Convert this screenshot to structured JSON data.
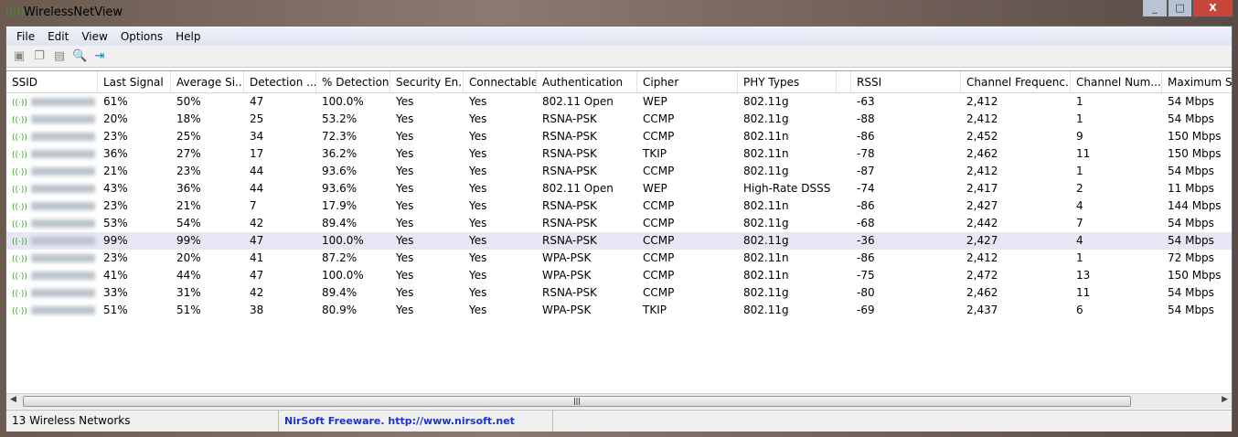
{
  "window": {
    "title": "WirelessNetView",
    "minimize": "_",
    "maximize": "□",
    "close": "X"
  },
  "menu": [
    "File",
    "Edit",
    "View",
    "Options",
    "Help"
  ],
  "toolbar": [
    {
      "icon": "save-icon",
      "glyph": "▣"
    },
    {
      "icon": "copy-icon",
      "glyph": "❐"
    },
    {
      "icon": "properties-icon",
      "glyph": "▤"
    },
    {
      "icon": "html-report-icon",
      "glyph": "🔍"
    },
    {
      "icon": "exit-icon",
      "glyph": "⇥"
    }
  ],
  "columns": [
    "SSID",
    "Last Signal",
    "Average Si...",
    "Detection ...",
    "% Detection",
    "Security En...",
    "Connectable",
    "Authentication",
    "Cipher",
    "PHY Types",
    "",
    "RSSI",
    "Channel Frequenc...",
    "Channel Num...",
    "Maximum Spe"
  ],
  "rows": [
    [
      "",
      "61%",
      "50%",
      "47",
      "100.0%",
      "Yes",
      "Yes",
      "802.11 Open",
      "WEP",
      "802.11g",
      "",
      "-63",
      "2,412",
      "1",
      "54 Mbps"
    ],
    [
      "",
      "20%",
      "18%",
      "25",
      "53.2%",
      "Yes",
      "Yes",
      "RSNA-PSK",
      "CCMP",
      "802.11g",
      "",
      "-88",
      "2,412",
      "1",
      "54 Mbps"
    ],
    [
      "",
      "23%",
      "25%",
      "34",
      "72.3%",
      "Yes",
      "Yes",
      "RSNA-PSK",
      "CCMP",
      "802.11n",
      "",
      "-86",
      "2,452",
      "9",
      "150 Mbps"
    ],
    [
      "",
      "36%",
      "27%",
      "17",
      "36.2%",
      "Yes",
      "Yes",
      "RSNA-PSK",
      "TKIP",
      "802.11n",
      "",
      "-78",
      "2,462",
      "11",
      "150 Mbps"
    ],
    [
      "",
      "21%",
      "23%",
      "44",
      "93.6%",
      "Yes",
      "Yes",
      "RSNA-PSK",
      "CCMP",
      "802.11g",
      "",
      "-87",
      "2,412",
      "1",
      "54 Mbps"
    ],
    [
      "",
      "43%",
      "36%",
      "44",
      "93.6%",
      "Yes",
      "Yes",
      "802.11 Open",
      "WEP",
      "High-Rate DSSS",
      "",
      "-74",
      "2,417",
      "2",
      "11 Mbps"
    ],
    [
      "",
      "23%",
      "21%",
      "7",
      "17.9%",
      "Yes",
      "Yes",
      "RSNA-PSK",
      "CCMP",
      "802.11n",
      "",
      "-86",
      "2,427",
      "4",
      "144 Mbps"
    ],
    [
      "",
      "53%",
      "54%",
      "42",
      "89.4%",
      "Yes",
      "Yes",
      "RSNA-PSK",
      "CCMP",
      "802.11g",
      "",
      "-68",
      "2,442",
      "7",
      "54 Mbps"
    ],
    [
      "",
      "99%",
      "99%",
      "47",
      "100.0%",
      "Yes",
      "Yes",
      "RSNA-PSK",
      "CCMP",
      "802.11g",
      "",
      "-36",
      "2,427",
      "4",
      "54 Mbps"
    ],
    [
      "",
      "23%",
      "20%",
      "41",
      "87.2%",
      "Yes",
      "Yes",
      "WPA-PSK",
      "CCMP",
      "802.11n",
      "",
      "-86",
      "2,412",
      "1",
      "72 Mbps"
    ],
    [
      "",
      "41%",
      "44%",
      "47",
      "100.0%",
      "Yes",
      "Yes",
      "WPA-PSK",
      "CCMP",
      "802.11n",
      "",
      "-75",
      "2,472",
      "13",
      "150 Mbps"
    ],
    [
      "",
      "33%",
      "31%",
      "42",
      "89.4%",
      "Yes",
      "Yes",
      "RSNA-PSK",
      "CCMP",
      "802.11g",
      "",
      "-80",
      "2,462",
      "11",
      "54 Mbps"
    ],
    [
      "",
      "51%",
      "51%",
      "38",
      "80.9%",
      "Yes",
      "Yes",
      "WPA-PSK",
      "TKIP",
      "802.11g",
      "",
      "-69",
      "2,437",
      "6",
      "54 Mbps"
    ]
  ],
  "selected_row": 8,
  "status": {
    "count": "13 Wireless Networks",
    "link": "NirSoft Freeware.  http://www.nirsoft.net"
  },
  "colors": {
    "link": "#1c34c8",
    "selection": "#e6e6f5",
    "signal_icon": "#3a9a2a"
  }
}
